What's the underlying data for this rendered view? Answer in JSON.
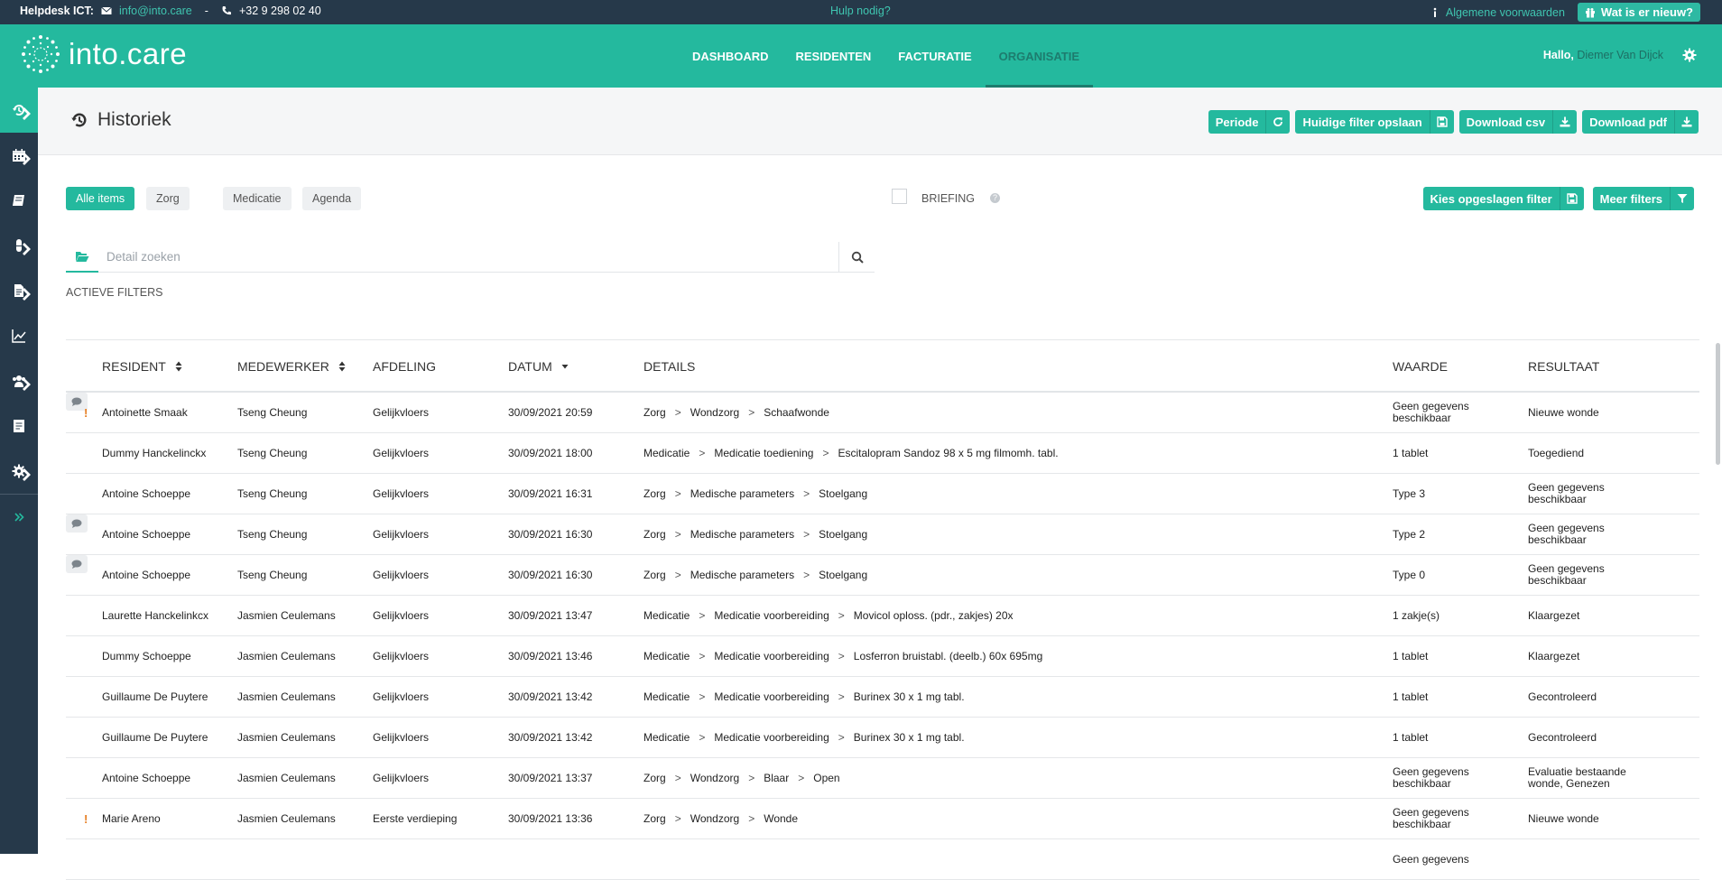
{
  "topbar": {
    "helpdesk_label": "Helpdesk ICT:",
    "email": "info@into.care",
    "dash": "-",
    "phone": "+32 9 298 02 40",
    "help": "Hulp nodig?",
    "terms": "Algemene voorwaarden",
    "whats_new": "Wat is er nieuw?"
  },
  "header": {
    "logo_text": "into.care",
    "nav": [
      "DASHBOARD",
      "RESIDENTEN",
      "FACTURATIE",
      "ORGANISATIE"
    ],
    "active_nav": "ORGANISATIE",
    "greeting": "Hallo,",
    "user_name": "Diemer Van Dijck"
  },
  "sidebar": {
    "items": [
      "history-icon",
      "calendar-icon",
      "book-icon",
      "pill-icon",
      "document-icon",
      "chart-icon",
      "group-icon",
      "report-icon",
      "settings-icon"
    ],
    "expand": "expand-icon"
  },
  "page": {
    "title": "Historiek",
    "actions": [
      "Periode",
      "Huidige filter opslaan",
      "Download csv",
      "Download pdf"
    ]
  },
  "filters": {
    "chips": [
      "Alle items",
      "Zorg",
      "Medicatie",
      "Agenda"
    ],
    "briefing": "BRIEFING",
    "help": "?",
    "saved_filter": "Kies opgeslagen filter",
    "more_filters": "Meer filters",
    "search_placeholder": "Detail zoeken",
    "active_filters": "ACTIEVE FILTERS"
  },
  "table": {
    "columns": [
      "RESIDENT",
      "MEDEWERKER",
      "AFDELING",
      "DATUM",
      "DETAILS",
      "WAARDE",
      "RESULTAAT"
    ],
    "rows": [
      {
        "flag": "!",
        "resident": "Antoinette Smaak",
        "medewerker": "Tseng Cheung",
        "afdeling": "Gelijkvloers",
        "datum": "30/09/2021 20:59",
        "details": [
          "Zorg",
          "Wondzorg",
          "Schaafwonde"
        ],
        "waarde": "Geen gegevens beschikbaar",
        "resultaat": "Nieuwe wonde",
        "comment": true
      },
      {
        "flag": "",
        "resident": "Dummy Hanckelinckx",
        "medewerker": "Tseng Cheung",
        "afdeling": "Gelijkvloers",
        "datum": "30/09/2021 18:00",
        "details": [
          "Medicatie",
          "Medicatie toediening",
          "Escitalopram Sandoz 98 x 5 mg filmomh. tabl."
        ],
        "waarde": "1 tablet",
        "resultaat": "Toegediend",
        "comment": false
      },
      {
        "flag": "",
        "resident": "Antoine Schoeppe",
        "medewerker": "Tseng Cheung",
        "afdeling": "Gelijkvloers",
        "datum": "30/09/2021 16:31",
        "details": [
          "Zorg",
          "Medische parameters",
          "Stoelgang"
        ],
        "waarde": "Type 3",
        "resultaat": "Geen gegevens beschikbaar",
        "comment": false
      },
      {
        "flag": "",
        "resident": "Antoine Schoeppe",
        "medewerker": "Tseng Cheung",
        "afdeling": "Gelijkvloers",
        "datum": "30/09/2021 16:30",
        "details": [
          "Zorg",
          "Medische parameters",
          "Stoelgang"
        ],
        "waarde": "Type 2",
        "resultaat": "Geen gegevens beschikbaar",
        "comment": true
      },
      {
        "flag": "",
        "resident": "Antoine Schoeppe",
        "medewerker": "Tseng Cheung",
        "afdeling": "Gelijkvloers",
        "datum": "30/09/2021 16:30",
        "details": [
          "Zorg",
          "Medische parameters",
          "Stoelgang"
        ],
        "waarde": "Type 0",
        "resultaat": "Geen gegevens beschikbaar",
        "comment": true
      },
      {
        "flag": "",
        "resident": "Laurette Hanckelinkcx",
        "medewerker": "Jasmien Ceulemans",
        "afdeling": "Gelijkvloers",
        "datum": "30/09/2021 13:47",
        "details": [
          "Medicatie",
          "Medicatie voorbereiding",
          "Movicol oploss. (pdr., zakjes) 20x"
        ],
        "waarde": "1 zakje(s)",
        "resultaat": "Klaargezet",
        "comment": false
      },
      {
        "flag": "",
        "resident": "Dummy Schoeppe",
        "medewerker": "Jasmien Ceulemans",
        "afdeling": "Gelijkvloers",
        "datum": "30/09/2021 13:46",
        "details": [
          "Medicatie",
          "Medicatie voorbereiding",
          "Losferron bruistabl. (deelb.) 60x 695mg"
        ],
        "waarde": "1 tablet",
        "resultaat": "Klaargezet",
        "comment": false
      },
      {
        "flag": "",
        "resident": "Guillaume De Puytere",
        "medewerker": "Jasmien Ceulemans",
        "afdeling": "Gelijkvloers",
        "datum": "30/09/2021 13:42",
        "details": [
          "Medicatie",
          "Medicatie voorbereiding",
          "Burinex 30 x 1 mg tabl."
        ],
        "waarde": "1 tablet",
        "resultaat": "Gecontroleerd",
        "comment": false
      },
      {
        "flag": "",
        "resident": "Guillaume De Puytere",
        "medewerker": "Jasmien Ceulemans",
        "afdeling": "Gelijkvloers",
        "datum": "30/09/2021 13:42",
        "details": [
          "Medicatie",
          "Medicatie voorbereiding",
          "Burinex 30 x 1 mg tabl."
        ],
        "waarde": "1 tablet",
        "resultaat": "Gecontroleerd",
        "comment": false
      },
      {
        "flag": "",
        "resident": "Antoine Schoeppe",
        "medewerker": "Jasmien Ceulemans",
        "afdeling": "Gelijkvloers",
        "datum": "30/09/2021 13:37",
        "details": [
          "Zorg",
          "Wondzorg",
          "Blaar",
          "Open"
        ],
        "waarde": "Geen gegevens beschikbaar",
        "resultaat": "Evaluatie bestaande wonde, Genezen",
        "comment": false
      },
      {
        "flag": "!",
        "resident": "Marie Areno",
        "medewerker": "Jasmien Ceulemans",
        "afdeling": "Eerste verdieping",
        "datum": "30/09/2021 13:36",
        "details": [
          "Zorg",
          "Wondzorg",
          "Wonde"
        ],
        "waarde": "Geen gegevens beschikbaar",
        "resultaat": "Nieuwe wonde",
        "comment": false
      },
      {
        "flag": "",
        "resident": "",
        "medewerker": "",
        "afdeling": "",
        "datum": "",
        "details": [],
        "waarde": "Geen gegevens",
        "resultaat": "",
        "comment": false
      }
    ]
  },
  "colors": {
    "brand": "#24b99e",
    "topbar": "#26394a",
    "sidebar": "#26394a",
    "flag": "#e67e22"
  }
}
